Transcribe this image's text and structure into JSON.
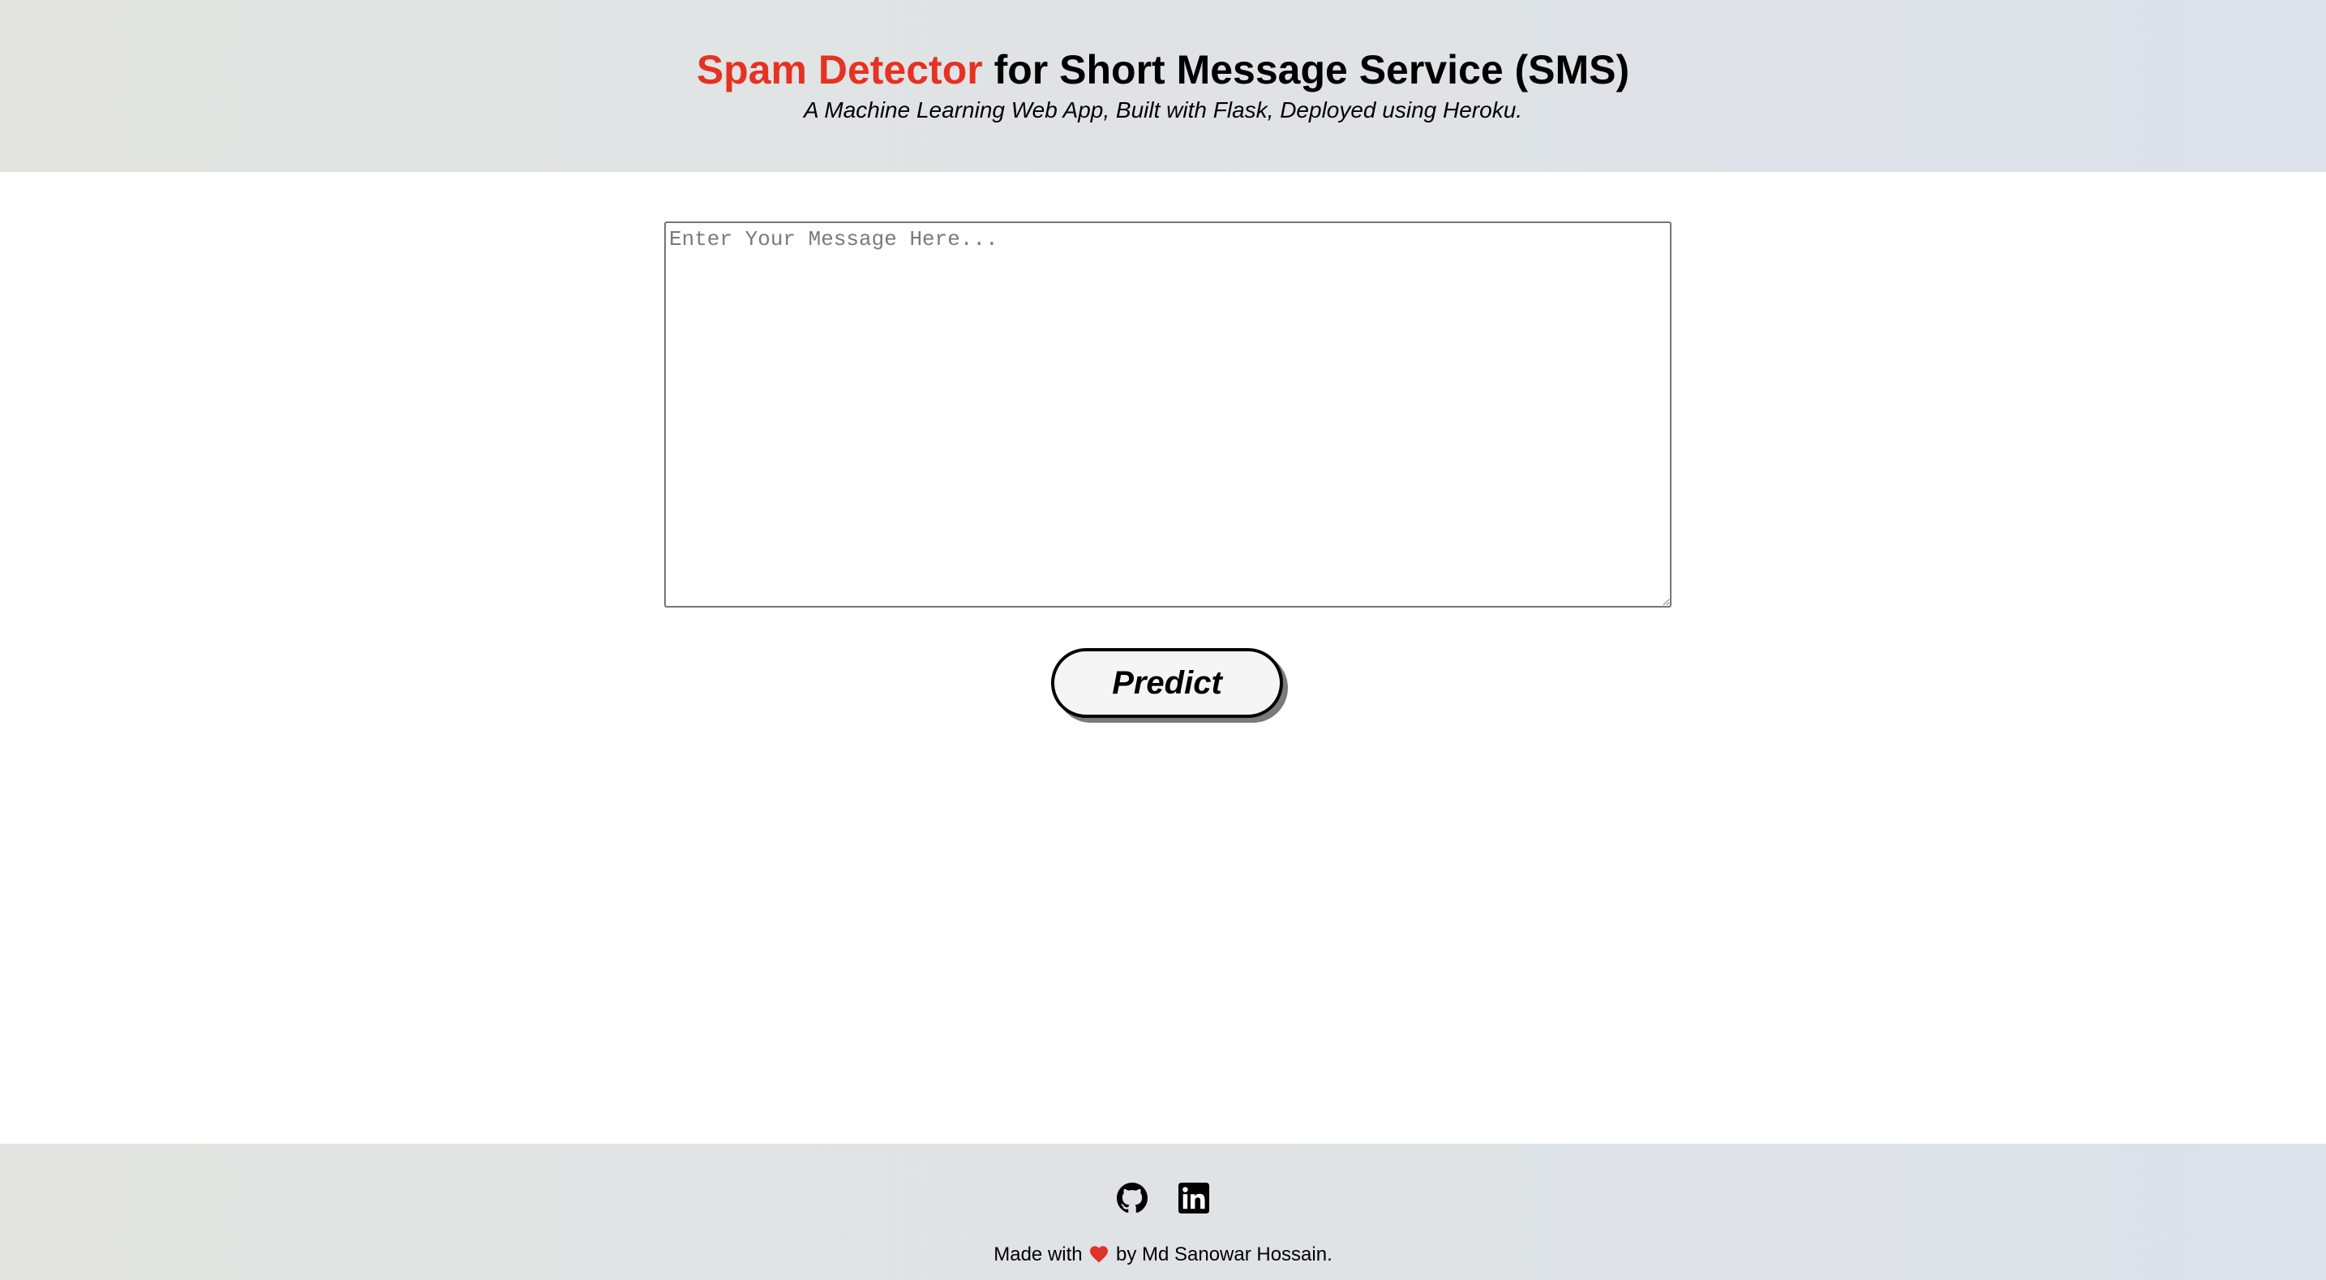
{
  "header": {
    "title_accent": "Spam Detector",
    "title_rest": " for Short Message Service (SMS)",
    "subtitle": "A Machine Learning Web App, Built with Flask, Deployed using Heroku."
  },
  "form": {
    "message_value": "",
    "message_placeholder": "Enter Your Message Here...",
    "predict_label": "Predict"
  },
  "footer": {
    "social_icons": [
      "github-icon",
      "linkedin-icon"
    ],
    "credit_before": "Made with ",
    "credit_icon": "heart-icon",
    "credit_after": " by Md Sanowar Hossain."
  },
  "colors": {
    "accent": "#e63222",
    "header_bg": "#e0e3e5",
    "heart": "#e0312a"
  }
}
